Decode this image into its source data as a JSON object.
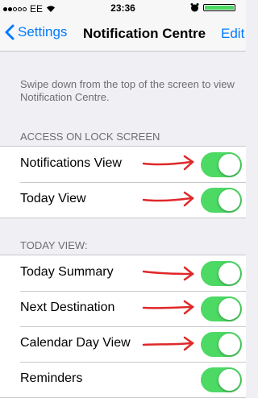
{
  "status_bar": {
    "carrier": "EE",
    "time": "23:36",
    "signal_icon": "signal-dots-icon",
    "wifi_icon": "wifi-icon",
    "alarm_icon": "alarm-icon",
    "battery_icon": "battery-icon",
    "battery_level": 1.0
  },
  "nav": {
    "back_label": "Settings",
    "title": "Notification Centre",
    "edit_label": "Edit"
  },
  "info_text": "Swipe down from the top of the screen to view Notification Centre.",
  "sections": {
    "lock_screen": {
      "header": "ACCESS ON LOCK SCREEN",
      "rows": [
        {
          "label": "Notifications View",
          "on": true
        },
        {
          "label": "Today View",
          "on": true
        }
      ]
    },
    "today_view": {
      "header": "TODAY VIEW:",
      "rows": [
        {
          "label": "Today Summary",
          "on": true
        },
        {
          "label": "Next Destination",
          "on": true
        },
        {
          "label": "Calendar Day View",
          "on": true
        },
        {
          "label": "Reminders",
          "on": true
        }
      ]
    }
  },
  "colors": {
    "accent": "#007aff",
    "toggle_on": "#4cd964",
    "background": "#efeff4",
    "annotation_arrow": "#e0282a"
  }
}
